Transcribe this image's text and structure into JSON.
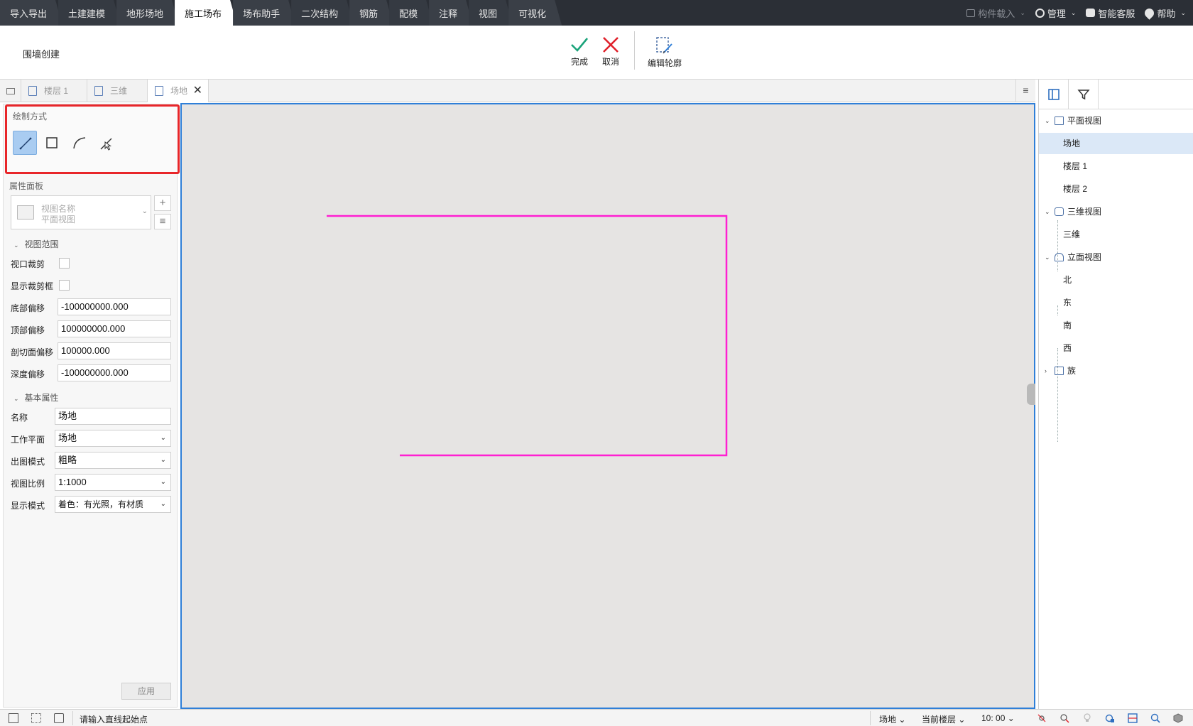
{
  "menubar": {
    "tabs": [
      "导入导出",
      "土建建模",
      "地形场地",
      "施工场布",
      "场布助手",
      "二次结构",
      "钢筋",
      "配模",
      "注释",
      "视图",
      "可视化"
    ],
    "active_tab": "施工场布",
    "right": {
      "component_load": "构件载入",
      "manage": "管理",
      "smart_service": "智能客服",
      "help": "帮助"
    }
  },
  "ribbon": {
    "title": "围墙创建",
    "finish": "完成",
    "cancel": "取消",
    "edit_outline": "编辑轮廓",
    "colors": {
      "finish": "#1aa37a",
      "cancel": "#e0202a"
    }
  },
  "view_tabs": [
    {
      "label": "楼层 1",
      "active": false
    },
    {
      "label": "三维",
      "active": false
    },
    {
      "label": "场地",
      "active": true
    }
  ],
  "left_panel": {
    "draw_mode_label": "绘制方式",
    "tools": [
      "line-tool-icon",
      "rectangle-tool-icon",
      "arc-tool-icon",
      "pick-line-tool-icon"
    ],
    "property_panel_label": "属性面板",
    "view_selector": {
      "line1": "视图名称",
      "line2": "平面视图"
    },
    "groups": {
      "view_range": "视图范围",
      "basic": "基本属性"
    },
    "view_range_rows": {
      "viewport_clip": "视口裁剪",
      "show_clip_box": "显示裁剪框",
      "bottom_offset_label": "底部偏移",
      "bottom_offset": "-100000000.000",
      "top_offset_label": "顶部偏移",
      "top_offset": "100000000.000",
      "cut_offset_label": "剖切面偏移",
      "cut_offset": "100000.000",
      "depth_offset_label": "深度偏移",
      "depth_offset": "-100000000.000"
    },
    "basic_rows": {
      "name_label": "名称",
      "name": "场地",
      "work_plane_label": "工作平面",
      "work_plane": "场地",
      "output_mode_label": "出图模式",
      "output_mode": "粗略",
      "view_scale_label": "视图比例",
      "view_scale": "1:1000",
      "display_mode_label": "显示模式",
      "display_mode": "着色：有光照，有材质"
    },
    "apply": "应用",
    "highlight_color": "#e8262a"
  },
  "canvas": {
    "background": "#e6e4e3",
    "line_color": "#ff1fd2"
  },
  "right_panel": {
    "tree": [
      {
        "type": "group",
        "label": "平面视图",
        "expanded": true
      },
      {
        "type": "leaf",
        "label": "场地",
        "selected": true
      },
      {
        "type": "leaf",
        "label": "楼层 1"
      },
      {
        "type": "leaf",
        "label": "楼层 2"
      },
      {
        "type": "group",
        "label": "三维视图",
        "expanded": true
      },
      {
        "type": "leaf",
        "label": "三维"
      },
      {
        "type": "group",
        "label": "立面视图",
        "expanded": true
      },
      {
        "type": "leaf",
        "label": "北"
      },
      {
        "type": "leaf",
        "label": "东"
      },
      {
        "type": "leaf",
        "label": "南"
      },
      {
        "type": "leaf",
        "label": "西"
      },
      {
        "type": "group",
        "label": "族",
        "expanded": false
      }
    ]
  },
  "statusbar": {
    "prompt": "请输入直线起始点",
    "view": "场地",
    "floor": "当前楼层",
    "time": "10: 00"
  }
}
